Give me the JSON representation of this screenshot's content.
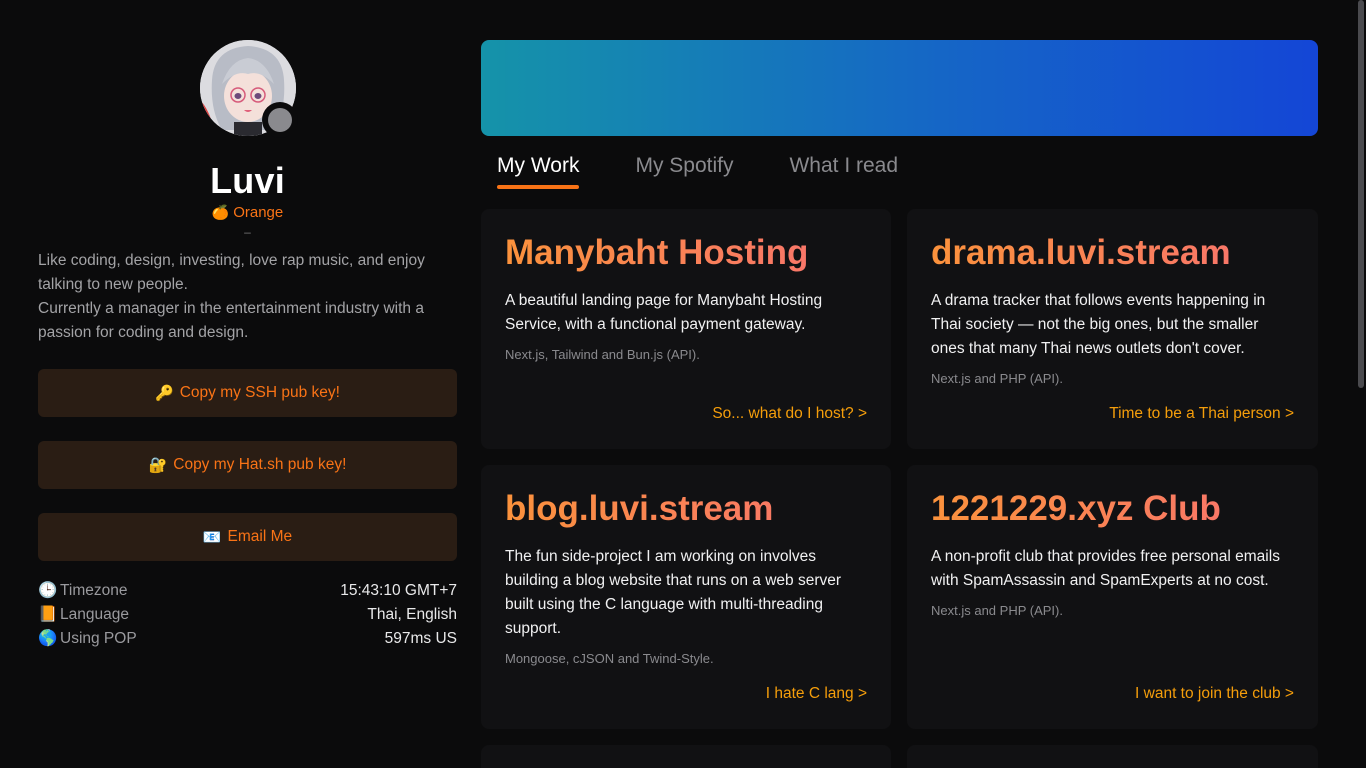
{
  "profile": {
    "name": "Luvi",
    "mood_emoji": "🍊",
    "mood": "Orange",
    "divider": "–",
    "bio": [
      "Like coding, design, investing, love rap music, and enjoy talking to new people.",
      "Currently a manager in the entertainment industry with a passion for coding and design."
    ]
  },
  "actions": [
    {
      "icon": "🔑",
      "icon_name": "key-icon",
      "label": "Copy my SSH pub key!"
    },
    {
      "icon": "🔐",
      "icon_name": "lock-icon",
      "label": "Copy my Hat.sh pub key!"
    },
    {
      "icon": "📧",
      "icon_name": "email-icon",
      "label": "Email Me"
    }
  ],
  "info": [
    {
      "icon": "🕒",
      "icon_name": "clock-icon",
      "key": "Timezone",
      "value": "15:43:10 GMT+7"
    },
    {
      "icon": "📙",
      "icon_name": "book-icon",
      "key": "Language",
      "value": "Thai, English"
    },
    {
      "icon": "🌎",
      "icon_name": "globe-icon",
      "key": "Using POP",
      "value": "597ms US"
    }
  ],
  "tabs": [
    {
      "label": "My Work",
      "active": true
    },
    {
      "label": "My Spotify",
      "active": false
    },
    {
      "label": "What I read",
      "active": false
    }
  ],
  "projects": [
    {
      "title": "Manybaht Hosting",
      "description": "A beautiful landing page for Manybaht Hosting Service, with a functional payment gateway.",
      "tech": "Next.js, Tailwind and Bun.js (API).",
      "link": "So... what do I host? >"
    },
    {
      "title": "drama.luvi.stream",
      "description": "A drama tracker that follows events happening in Thai society — not the big ones, but the smaller ones that many Thai news outlets don't cover.",
      "tech": "Next.js and PHP (API).",
      "link": "Time to be a Thai person >"
    },
    {
      "title": "blog.luvi.stream",
      "description": "The fun side-project I am working on involves building a blog website that runs on a web server built using the C language with multi-threading support.",
      "tech": "Mongoose, cJSON and Twind-Style.",
      "link": "I hate C lang >"
    },
    {
      "title": "1221229.xyz Club",
      "description": "A non-profit club that provides free personal emails with SpamAssassin and SpamExperts at no cost.",
      "tech": "Next.js and PHP (API).",
      "link": "I want to join the club >"
    }
  ],
  "colors": {
    "accent": "#f97316",
    "link": "#f59e0b",
    "button_bg": "#2a1d14",
    "card_bg": "#111113",
    "page_bg": "#0b0b0c"
  }
}
